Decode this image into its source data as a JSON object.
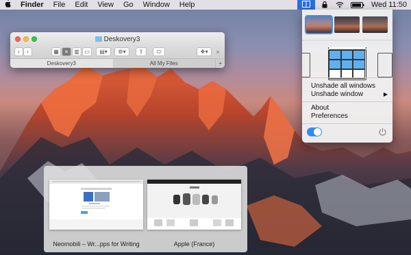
{
  "menubar": {
    "apple_icon": "apple-logo-icon",
    "app_name": "Finder",
    "items": [
      "File",
      "Edit",
      "View",
      "Go",
      "Window",
      "Help"
    ],
    "clock": "Wed 11:50",
    "status_icons": [
      "deskovery-icon",
      "lock-icon",
      "wifi-icon",
      "battery-icon"
    ]
  },
  "finder": {
    "title": "Deskovery3",
    "tabs": [
      "Deskovery3",
      "All My Files"
    ],
    "add_tab": "+"
  },
  "panel": {
    "menu": {
      "unshade_all": "Unshade all windows",
      "unshade_window": "Unshade window",
      "about": "About",
      "preferences": "Preferences"
    },
    "toggle_on": true,
    "accent": "#2f8df5"
  },
  "switcher": {
    "windows": [
      {
        "label": "Neomobili – Wr...pps for Writing"
      },
      {
        "label": "Apple (France)"
      }
    ]
  }
}
